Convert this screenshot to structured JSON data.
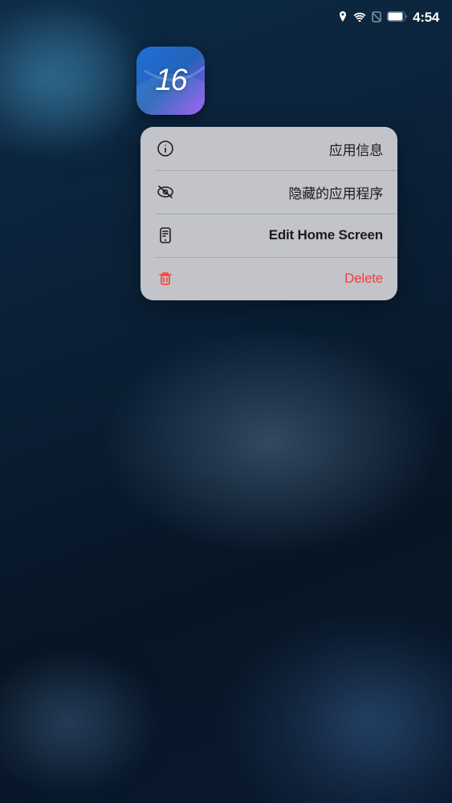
{
  "statusBar": {
    "time": "4:54",
    "icons": {
      "location": "◎",
      "wifi": "▲",
      "noSim": "□",
      "battery": "▮"
    }
  },
  "appIcon": {
    "number": "16",
    "ariaLabel": "iOS 16 App Icon"
  },
  "contextMenu": {
    "items": [
      {
        "id": "app-info",
        "label": "应用信息",
        "iconType": "info",
        "isRed": false,
        "isBold": false
      },
      {
        "id": "hide-app",
        "label": "隐藏的应用程序",
        "iconType": "eye-slash",
        "isRed": false,
        "isBold": false
      },
      {
        "id": "edit-home",
        "label": "Edit Home Screen",
        "iconType": "phone-screen",
        "isRed": false,
        "isBold": true
      },
      {
        "id": "delete",
        "label": "Delete",
        "iconType": "trash",
        "isRed": true,
        "isBold": false
      }
    ]
  }
}
